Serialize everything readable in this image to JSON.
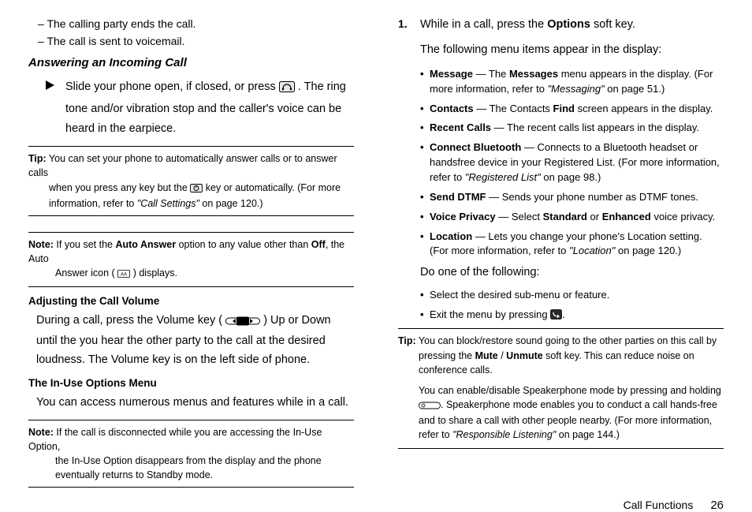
{
  "left": {
    "dashItems": [
      "The calling party ends the call.",
      "The call is sent to voicemail."
    ],
    "answeringHeading": "Answering an Incoming Call",
    "answeringBody_a": "Slide your phone open, if closed, or press ",
    "answeringBody_b": ". The ring tone and/or vibration stop and the caller's voice can be heard in the earpiece.",
    "tip1_label": "Tip:",
    "tip1_a": " You can set your phone to automatically answer calls or to answer calls",
    "tip1_b": "when you press any key but the ",
    "tip1_c": " key or automatically. (For more information, refer to ",
    "tip1_ref": "\"Call Settings\"",
    "tip1_d": " on page 120.)",
    "note1_label": "Note:",
    "note1_a": " If you set the ",
    "note1_b": "Auto Answer",
    "note1_c": " option to any value other than ",
    "note1_d": "Off",
    "note1_e": ", the Auto",
    "note1_f": "Answer icon (",
    "note1_g": ") displays.",
    "adjustHeading": "Adjusting the Call Volume",
    "adjustBody_a": "During a call, press the Volume key ( ",
    "adjustBody_b": " ) Up or Down until the you hear the other party to the call at the desired loudness. The Volume key is on the left side of phone.",
    "inUseHeading": "The In-Use Options Menu",
    "inUseBody": "You can access numerous menus and features while in a call.",
    "note2_label": "Note:",
    "note2_a": " If the call is disconnected while you are accessing the In-Use Option,",
    "note2_b": "the In-Use Option disappears from the display and the phone eventually returns to Standby mode."
  },
  "right": {
    "step_num": "1.",
    "step_a": "While in a call, press the ",
    "step_b": "Options",
    "step_c": " soft key.",
    "menuIntro": "The following menu items appear in the display:",
    "bullets": [
      {
        "head": "Message",
        "tail_a": " — The ",
        "b1": "Messages",
        "tail_b": " menu appears in the display. (For more information, refer to ",
        "ref": "\"Messaging\"",
        "tail_c": " on page 51.)"
      },
      {
        "head": "Contacts",
        "tail_a": " — The Contacts ",
        "b1": "Find",
        "tail_b": " screen appears in the display.",
        "ref": "",
        "tail_c": ""
      },
      {
        "head": "Recent Calls",
        "tail_a": " — The recent calls list appears in the display.",
        "b1": "",
        "tail_b": "",
        "ref": "",
        "tail_c": ""
      },
      {
        "head": "Connect Bluetooth",
        "tail_a": " — Connects to a Bluetooth headset or handsfree device in your Registered List. (For more information, refer to ",
        "b1": "",
        "tail_b": "",
        "ref": "\"Registered List\"",
        "tail_c": " on page 98.)"
      },
      {
        "head": "Send DTMF",
        "tail_a": " — Sends your phone number as DTMF tones.",
        "b1": "",
        "tail_b": "",
        "ref": "",
        "tail_c": ""
      },
      {
        "head": "Voice Privacy",
        "tail_a": " — Select ",
        "b1": "Standard",
        "tail_b": " or ",
        "b2": "Enhanced",
        "tail_c": " voice privacy."
      },
      {
        "head": "Location",
        "tail_a": " — Lets you change your phone's Location setting. (For more information, refer to ",
        "b1": "",
        "tail_b": "",
        "ref": "\"Location\"",
        "tail_c": " on page 120.)"
      }
    ],
    "doOne": "Do one of the following:",
    "subBullets": [
      "Select the desired sub-menu or feature.",
      "Exit the menu by pressing "
    ],
    "tip2_label": "Tip:",
    "tip2_a": " You can block/restore sound going to the other parties on this call by",
    "tip2_b": "pressing the ",
    "tip2_mute": "Mute",
    "tip2_slash": " / ",
    "tip2_unmute": "Unmute",
    "tip2_c": " soft key. This can reduce noise on conference calls.",
    "tip2_p2a": "You can enable/disable Speakerphone mode by pressing and holding",
    "tip2_p2b": ". Speakerphone mode enables you to conduct a call hands-free and to share a call with other people nearby. (For more information, refer to ",
    "tip2_ref": "\"Responsible Listening\"",
    "tip2_p2c": " on page 144.)"
  },
  "footer": {
    "section": "Call Functions",
    "page": "26"
  }
}
